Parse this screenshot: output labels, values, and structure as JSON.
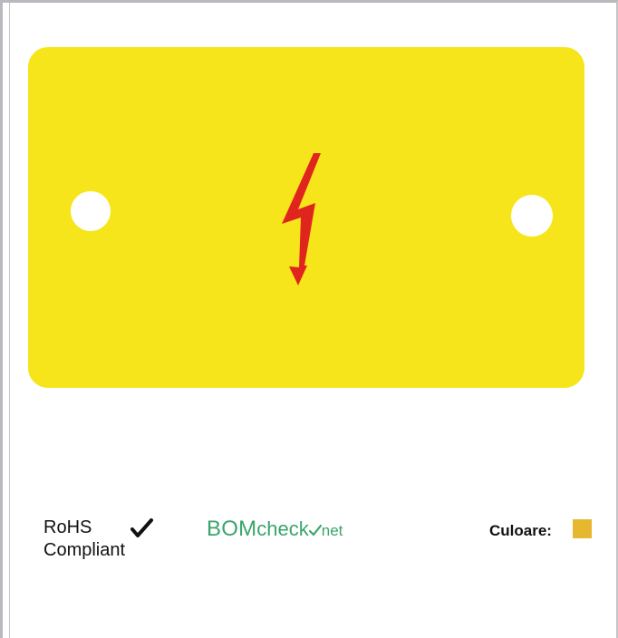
{
  "product": {
    "image_icon": "high-voltage-lightning-icon",
    "plate_color": "#f6e51a",
    "bolt_color": "#e0251f"
  },
  "compliance": {
    "rohs_line1": "RoHS",
    "rohs_line2": "Compliant",
    "check_icon": "checkmark-icon"
  },
  "bomcheck": {
    "part1": "BOM",
    "part2": "check",
    "part3": "net",
    "color": "#3aa56a"
  },
  "color_info": {
    "label": "Culoare:",
    "swatch": "#e6b830"
  }
}
